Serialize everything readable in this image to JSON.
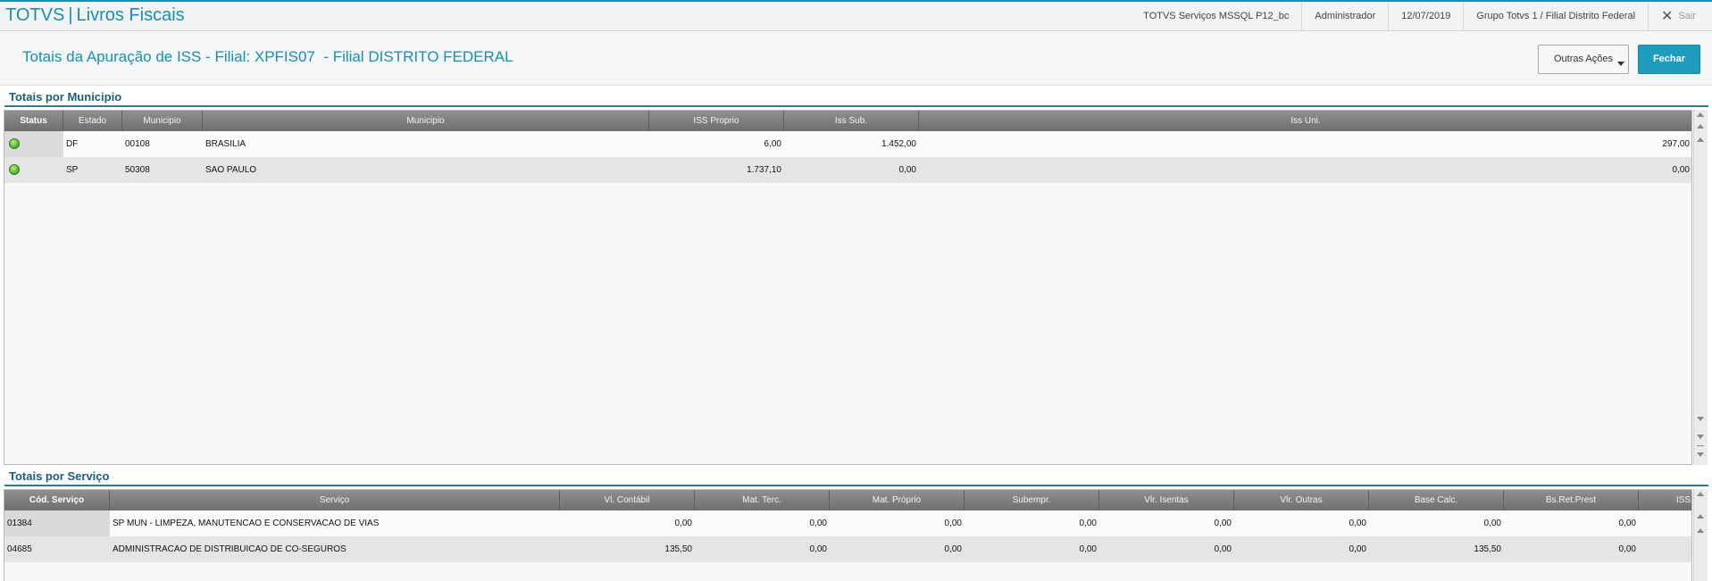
{
  "app": {
    "name": "TOTVS",
    "module": "Livros Fiscais"
  },
  "topbar": {
    "environment": "TOTVS Serviços MSSQL P12_bc",
    "user": "Administrador",
    "date": "12/07/2019",
    "branch": "Grupo Totvs 1 / Filial Distrito Federal",
    "logout_label": "Sair"
  },
  "header": {
    "title": "Totais da Apuração de ISS - Filial: XPFIS07  - Filial DISTRITO FEDERAL",
    "outras_acoes_label": "Outras Ações",
    "fechar_label": "Fechar"
  },
  "municipio_section": {
    "label": "Totais por Municipio",
    "columns": [
      "Status",
      "Estado",
      "Municipio",
      "Municipio",
      "ISS Proprio",
      "Iss Sub.",
      "Iss Uni."
    ],
    "rows": [
      {
        "status": "green",
        "estado": "DF",
        "codigo": "00108",
        "municipio": "BRASILIA",
        "iss_proprio": "6,00",
        "iss_sub": "1.452,00",
        "iss_uni": "297,00"
      },
      {
        "status": "green",
        "estado": "SP",
        "codigo": "50308",
        "municipio": "SAO PAULO",
        "iss_proprio": "1.737,10",
        "iss_sub": "0,00",
        "iss_uni": "0,00"
      }
    ]
  },
  "servico_section": {
    "label": "Totais por Serviço",
    "columns": [
      "Cód. Serviço",
      "Serviço",
      "Vl. Contábil",
      "Mat. Terc.",
      "Mat. Próprio",
      "Subempr.",
      "Vlr. Isentas",
      "Vlr. Outras",
      "Base Calc.",
      "Bs.Ret.Prest",
      "ISS"
    ],
    "rows": [
      {
        "codigo": "01384",
        "servico": "SP MUN - LIMPEZA, MANUTENCAO E CONSERVACAO DE VIAS",
        "vl_contabil": "0,00",
        "mat_terc": "0,00",
        "mat_proprio": "0,00",
        "subempr": "0,00",
        "vlr_isentas": "0,00",
        "vlr_outras": "0,00",
        "base_calc": "0,00",
        "bs_ret_prest": "0,00"
      },
      {
        "codigo": "04685",
        "servico": "ADMINISTRACAO DE DISTRIBUICAO DE CO-SEGUROS",
        "vl_contabil": "135,50",
        "mat_terc": "0,00",
        "mat_proprio": "0,00",
        "subempr": "0,00",
        "vlr_isentas": "0,00",
        "vlr_outras": "0,00",
        "base_calc": "135,50",
        "bs_ret_prest": "0,00"
      }
    ]
  },
  "colors": {
    "accent": "#1790b0",
    "primary_button": "#1d9cbe",
    "status_ok": "#4daa2a"
  }
}
